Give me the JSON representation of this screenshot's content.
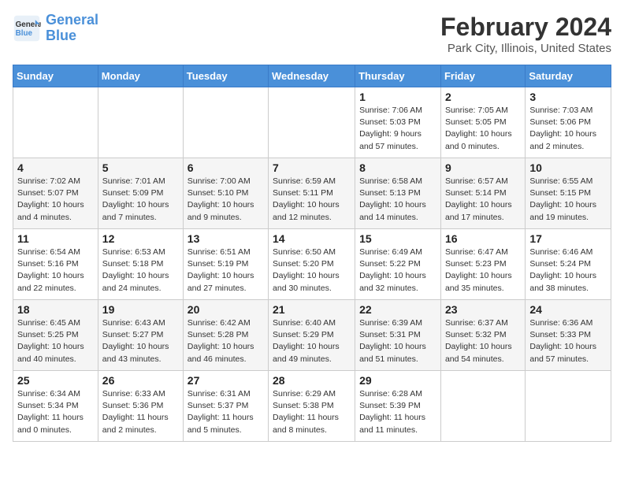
{
  "header": {
    "logo_line1": "General",
    "logo_line2": "Blue",
    "title": "February 2024",
    "subtitle": "Park City, Illinois, United States"
  },
  "weekdays": [
    "Sunday",
    "Monday",
    "Tuesday",
    "Wednesday",
    "Thursday",
    "Friday",
    "Saturday"
  ],
  "weeks": [
    [
      {
        "day": "",
        "info": ""
      },
      {
        "day": "",
        "info": ""
      },
      {
        "day": "",
        "info": ""
      },
      {
        "day": "",
        "info": ""
      },
      {
        "day": "1",
        "info": "Sunrise: 7:06 AM\nSunset: 5:03 PM\nDaylight: 9 hours and 57 minutes."
      },
      {
        "day": "2",
        "info": "Sunrise: 7:05 AM\nSunset: 5:05 PM\nDaylight: 10 hours and 0 minutes."
      },
      {
        "day": "3",
        "info": "Sunrise: 7:03 AM\nSunset: 5:06 PM\nDaylight: 10 hours and 2 minutes."
      }
    ],
    [
      {
        "day": "4",
        "info": "Sunrise: 7:02 AM\nSunset: 5:07 PM\nDaylight: 10 hours and 4 minutes."
      },
      {
        "day": "5",
        "info": "Sunrise: 7:01 AM\nSunset: 5:09 PM\nDaylight: 10 hours and 7 minutes."
      },
      {
        "day": "6",
        "info": "Sunrise: 7:00 AM\nSunset: 5:10 PM\nDaylight: 10 hours and 9 minutes."
      },
      {
        "day": "7",
        "info": "Sunrise: 6:59 AM\nSunset: 5:11 PM\nDaylight: 10 hours and 12 minutes."
      },
      {
        "day": "8",
        "info": "Sunrise: 6:58 AM\nSunset: 5:13 PM\nDaylight: 10 hours and 14 minutes."
      },
      {
        "day": "9",
        "info": "Sunrise: 6:57 AM\nSunset: 5:14 PM\nDaylight: 10 hours and 17 minutes."
      },
      {
        "day": "10",
        "info": "Sunrise: 6:55 AM\nSunset: 5:15 PM\nDaylight: 10 hours and 19 minutes."
      }
    ],
    [
      {
        "day": "11",
        "info": "Sunrise: 6:54 AM\nSunset: 5:16 PM\nDaylight: 10 hours and 22 minutes."
      },
      {
        "day": "12",
        "info": "Sunrise: 6:53 AM\nSunset: 5:18 PM\nDaylight: 10 hours and 24 minutes."
      },
      {
        "day": "13",
        "info": "Sunrise: 6:51 AM\nSunset: 5:19 PM\nDaylight: 10 hours and 27 minutes."
      },
      {
        "day": "14",
        "info": "Sunrise: 6:50 AM\nSunset: 5:20 PM\nDaylight: 10 hours and 30 minutes."
      },
      {
        "day": "15",
        "info": "Sunrise: 6:49 AM\nSunset: 5:22 PM\nDaylight: 10 hours and 32 minutes."
      },
      {
        "day": "16",
        "info": "Sunrise: 6:47 AM\nSunset: 5:23 PM\nDaylight: 10 hours and 35 minutes."
      },
      {
        "day": "17",
        "info": "Sunrise: 6:46 AM\nSunset: 5:24 PM\nDaylight: 10 hours and 38 minutes."
      }
    ],
    [
      {
        "day": "18",
        "info": "Sunrise: 6:45 AM\nSunset: 5:25 PM\nDaylight: 10 hours and 40 minutes."
      },
      {
        "day": "19",
        "info": "Sunrise: 6:43 AM\nSunset: 5:27 PM\nDaylight: 10 hours and 43 minutes."
      },
      {
        "day": "20",
        "info": "Sunrise: 6:42 AM\nSunset: 5:28 PM\nDaylight: 10 hours and 46 minutes."
      },
      {
        "day": "21",
        "info": "Sunrise: 6:40 AM\nSunset: 5:29 PM\nDaylight: 10 hours and 49 minutes."
      },
      {
        "day": "22",
        "info": "Sunrise: 6:39 AM\nSunset: 5:31 PM\nDaylight: 10 hours and 51 minutes."
      },
      {
        "day": "23",
        "info": "Sunrise: 6:37 AM\nSunset: 5:32 PM\nDaylight: 10 hours and 54 minutes."
      },
      {
        "day": "24",
        "info": "Sunrise: 6:36 AM\nSunset: 5:33 PM\nDaylight: 10 hours and 57 minutes."
      }
    ],
    [
      {
        "day": "25",
        "info": "Sunrise: 6:34 AM\nSunset: 5:34 PM\nDaylight: 11 hours and 0 minutes."
      },
      {
        "day": "26",
        "info": "Sunrise: 6:33 AM\nSunset: 5:36 PM\nDaylight: 11 hours and 2 minutes."
      },
      {
        "day": "27",
        "info": "Sunrise: 6:31 AM\nSunset: 5:37 PM\nDaylight: 11 hours and 5 minutes."
      },
      {
        "day": "28",
        "info": "Sunrise: 6:29 AM\nSunset: 5:38 PM\nDaylight: 11 hours and 8 minutes."
      },
      {
        "day": "29",
        "info": "Sunrise: 6:28 AM\nSunset: 5:39 PM\nDaylight: 11 hours and 11 minutes."
      },
      {
        "day": "",
        "info": ""
      },
      {
        "day": "",
        "info": ""
      }
    ]
  ]
}
